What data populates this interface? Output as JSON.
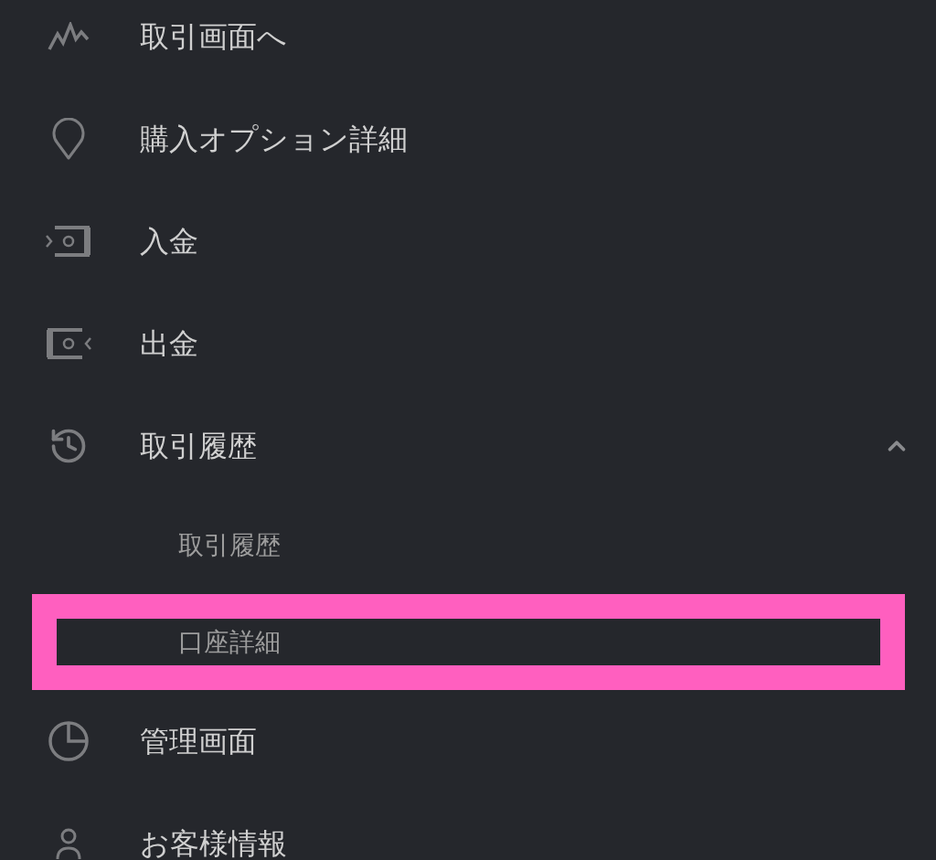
{
  "menu": {
    "items": [
      {
        "label": "取引画面へ"
      },
      {
        "label": "購入オプション詳細"
      },
      {
        "label": "入金"
      },
      {
        "label": "出金"
      },
      {
        "label": "取引履歴",
        "expanded": true,
        "children": [
          {
            "label": "取引履歴",
            "highlighted": false
          },
          {
            "label": "口座詳細",
            "highlighted": true
          }
        ]
      },
      {
        "label": "管理画面"
      },
      {
        "label": "お客様情報"
      }
    ]
  }
}
